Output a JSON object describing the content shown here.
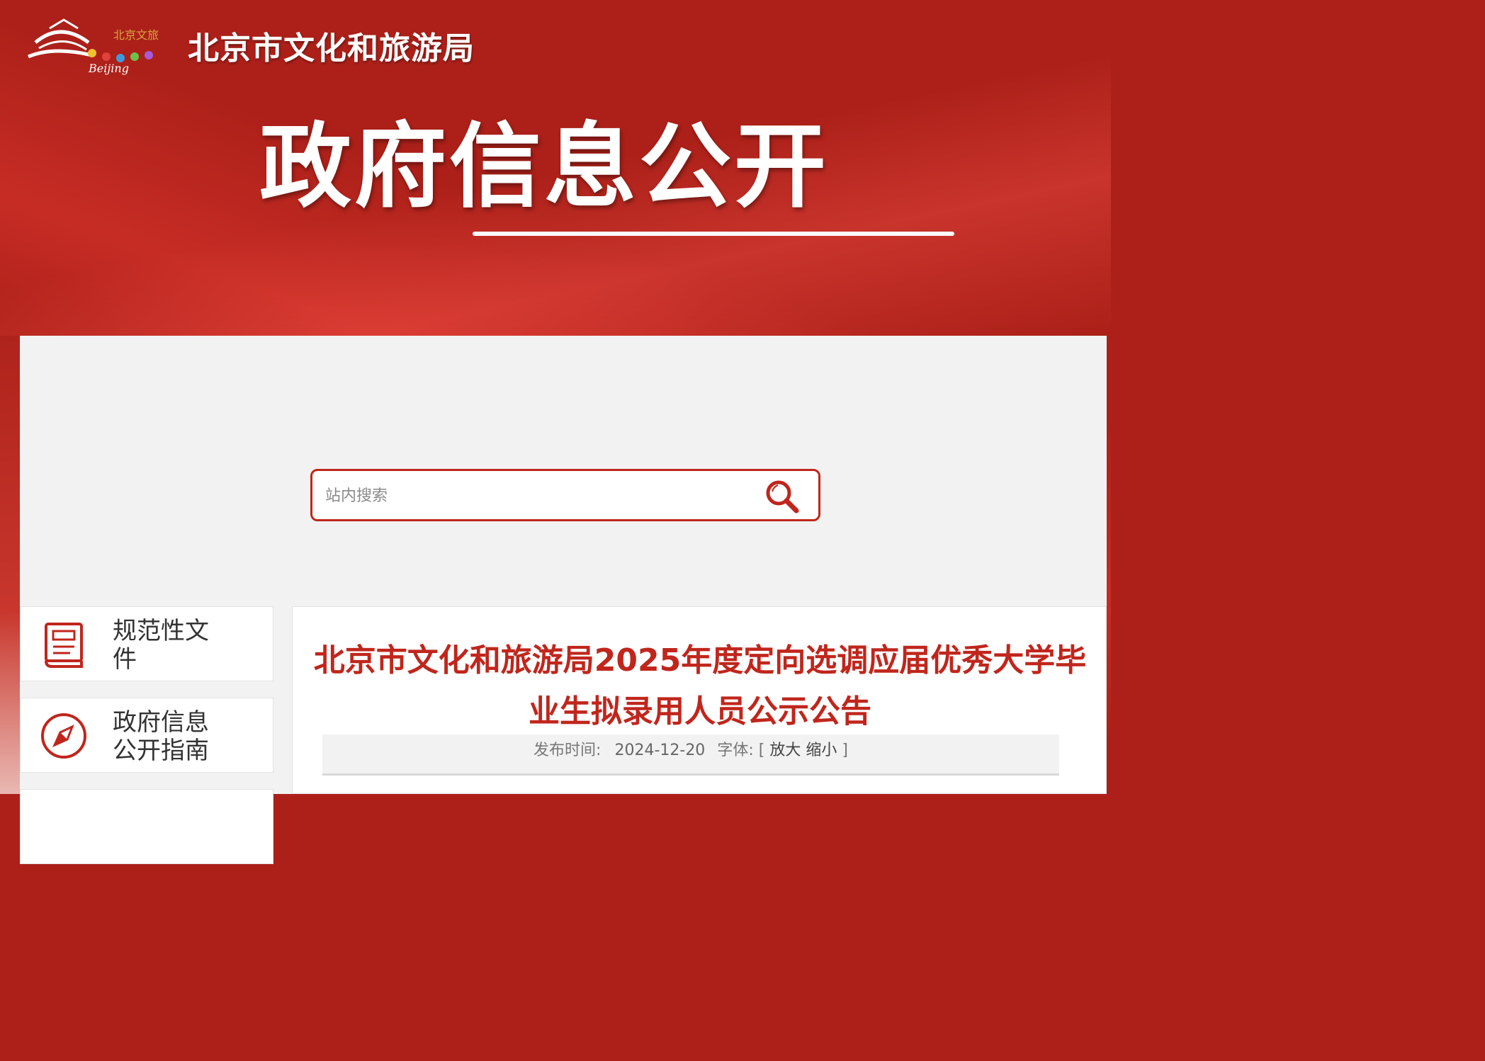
{
  "header": {
    "site_name": "北京市文化和旅游局",
    "banner_title": "政府信息公开",
    "logo_text": "Beijing",
    "logo_tag": "北京文旅"
  },
  "search": {
    "placeholder": "站内搜索"
  },
  "sidebar": {
    "items": [
      {
        "label": "规范性文件",
        "icon": "document-icon"
      },
      {
        "label": "政府信息公开指南",
        "icon": "compass-icon"
      }
    ]
  },
  "article": {
    "title": "北京市文化和旅游局2025年度定向选调应届优秀大学毕业生拟录用人员公示公告",
    "meta_publish_label": "发布时间:",
    "meta_date": "2024-12-20",
    "meta_font_label": "字体:",
    "bracket_open": "[",
    "font_enlarge": "放大",
    "font_shrink": "缩小",
    "bracket_close": "]"
  },
  "colors": {
    "banner_red": "#ac2019",
    "accent_red": "#c0261c",
    "panel_gray": "#f2f2f2"
  }
}
